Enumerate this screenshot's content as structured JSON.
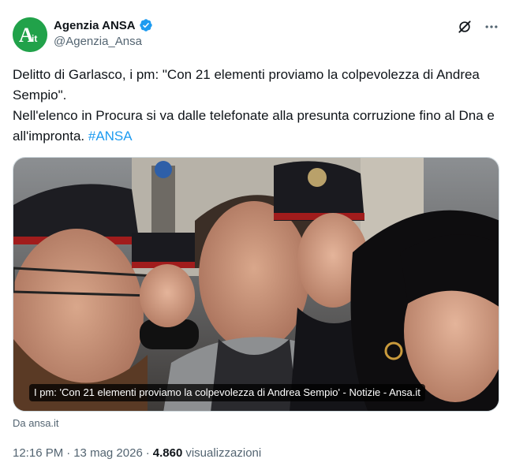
{
  "author": {
    "display_name": "Agenzia ANSA",
    "handle": "@Agenzia_Ansa",
    "avatar_text": "A",
    "avatar_subtext": "it",
    "verified": true,
    "verified_color": "#1d9bf0",
    "avatar_color": "#21a24a"
  },
  "actions": {
    "grok_icon": "grok-icon",
    "more_icon": "more-icon"
  },
  "tweet": {
    "line1": "Delitto di Garlasco, i pm: \"Con 21 elementi proviamo la colpevolezza di Andrea Sempio\".",
    "line2": "Nell'elenco in Procura si va dalle telefonate alla presunta corruzione fino al Dna e all'impronta.",
    "hashtag": "#ANSA"
  },
  "card": {
    "caption": "I pm: 'Con 21 elementi proviamo la colpevolezza di Andrea Sempio' - Notizie - Ansa.it",
    "source": "Da ansa.it"
  },
  "meta": {
    "time": "12:16 PM",
    "separator": "·",
    "date": "13 mag 2026",
    "views_count": "4.860",
    "views_label": "visualizzazioni"
  },
  "colors": {
    "link": "#1d9bf0",
    "secondary_text": "#536471",
    "primary_text": "#0f1419"
  }
}
